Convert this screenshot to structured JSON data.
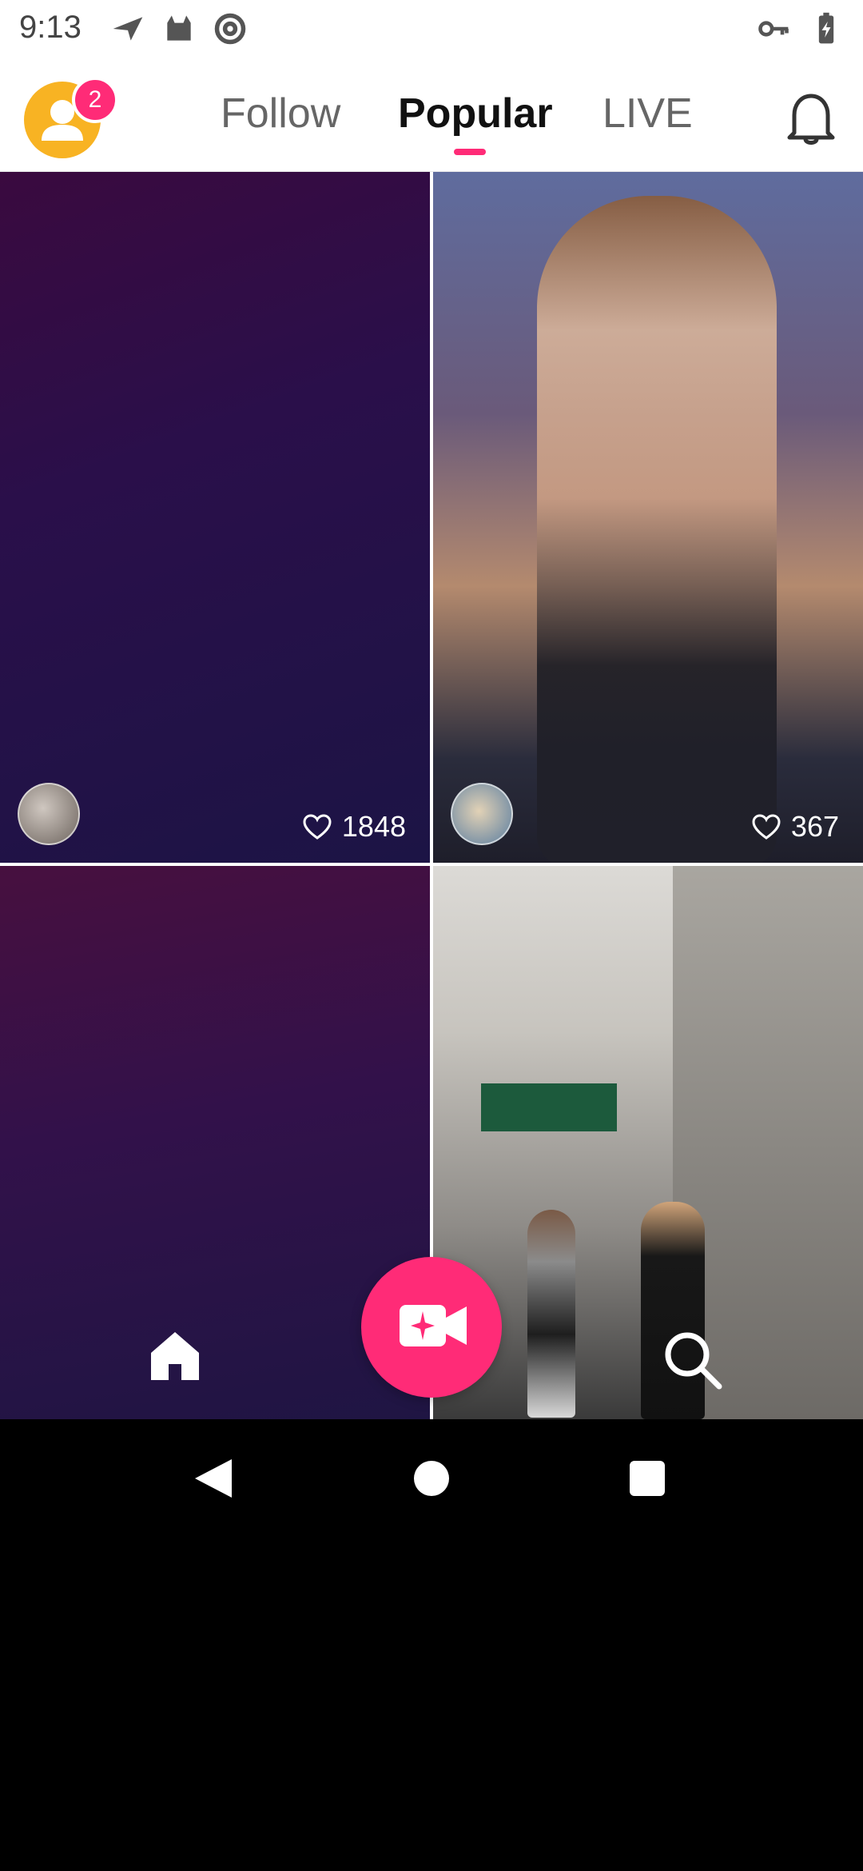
{
  "status_bar": {
    "time": "9:13",
    "left_icons": [
      "send-icon",
      "cat-icon",
      "at-sign-icon"
    ],
    "right_icons": [
      "key-icon",
      "battery-charging-icon"
    ]
  },
  "header": {
    "notification_count": "2",
    "tabs": [
      {
        "label": "Follow",
        "active": false
      },
      {
        "label": "Popular",
        "active": true
      },
      {
        "label": "LIVE",
        "active": false
      }
    ],
    "accent_color": "#ff2b77"
  },
  "feed": {
    "cards": [
      {
        "likes": "1848"
      },
      {
        "likes": "367"
      },
      {
        "likes": ""
      },
      {
        "likes": ""
      }
    ]
  },
  "bottom_nav": {
    "items": [
      "home-icon",
      "record-video-icon",
      "search-icon"
    ]
  }
}
